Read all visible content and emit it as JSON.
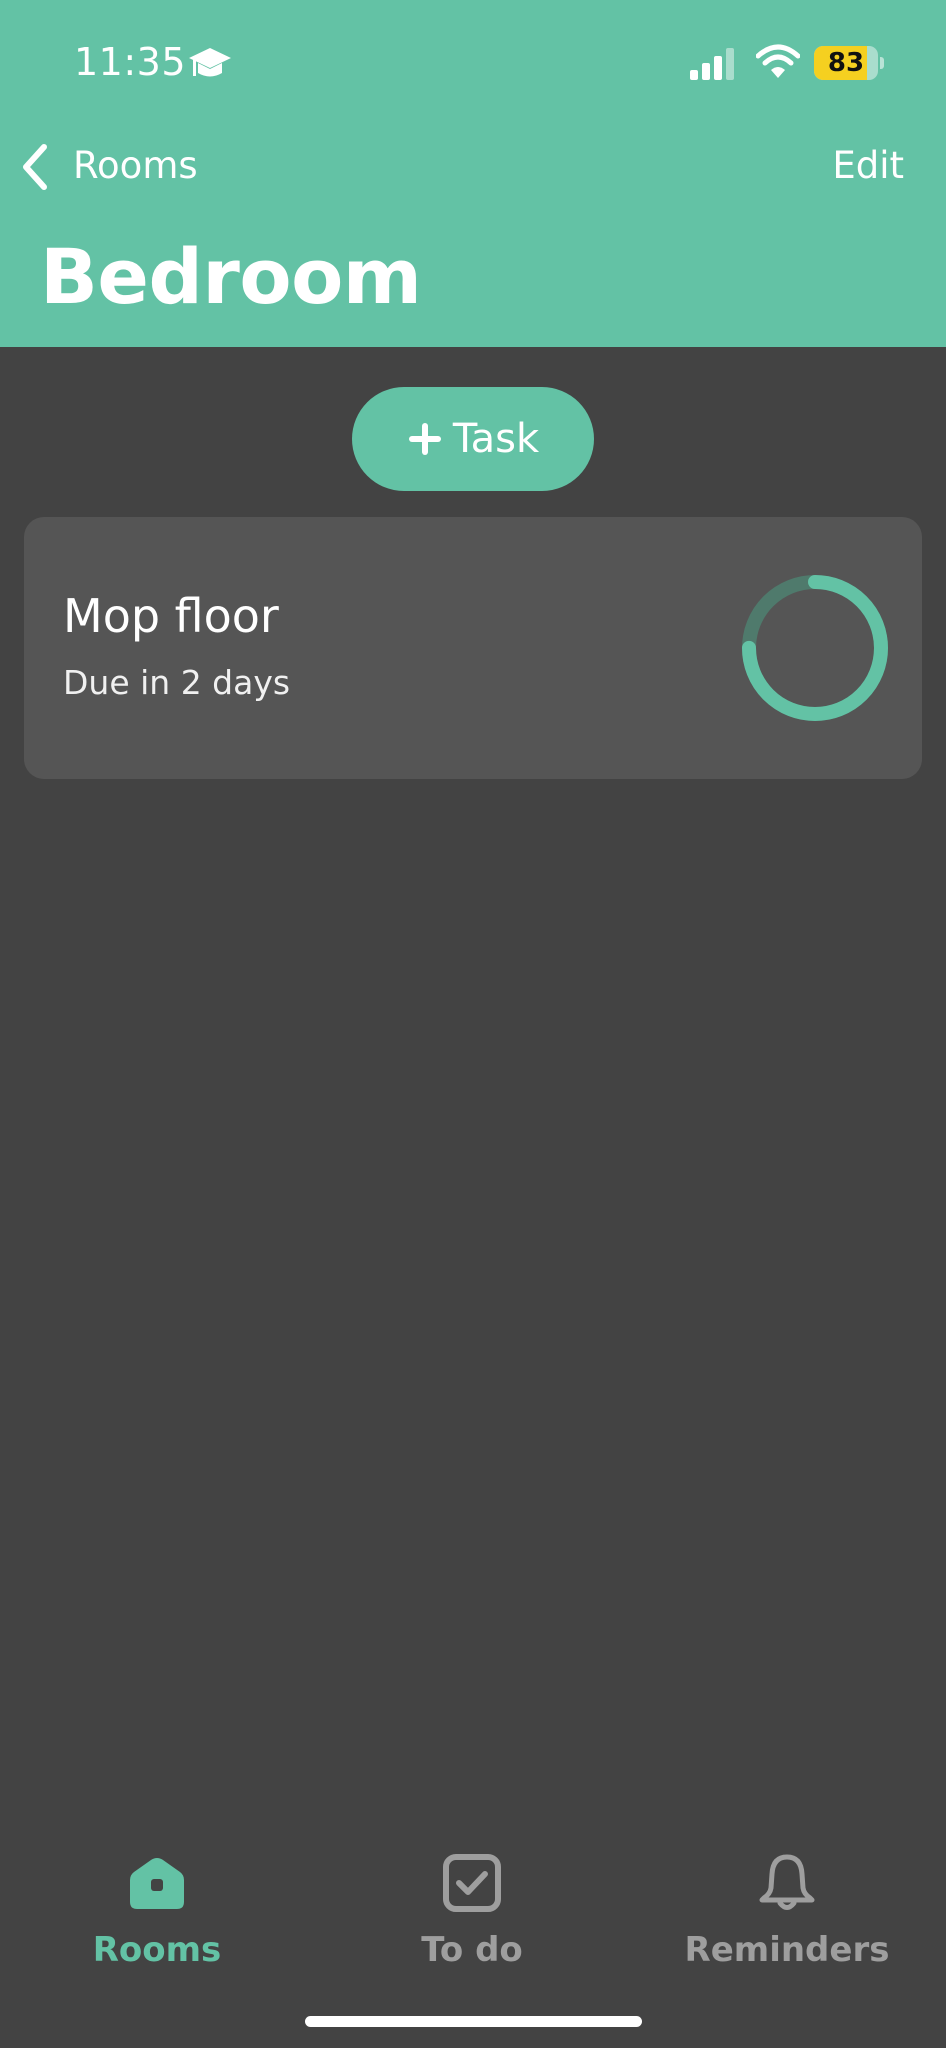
{
  "status_bar": {
    "time": "11:35",
    "battery_level": "83",
    "battery_fraction": 0.83
  },
  "nav": {
    "back_label": "Rooms",
    "edit_label": "Edit",
    "title": "Bedroom"
  },
  "add_task": {
    "label": "Task",
    "icon": "plus-icon"
  },
  "tasks": [
    {
      "title": "Mop floor",
      "due": "Due in 2 days",
      "progress_fraction": 0.75
    }
  ],
  "tab_bar": {
    "items": [
      {
        "label": "Rooms",
        "icon": "house-icon",
        "selected": true
      },
      {
        "label": "To do",
        "icon": "checkbox-icon",
        "selected": false
      },
      {
        "label": "Reminders",
        "icon": "bell-icon",
        "selected": false
      }
    ]
  },
  "colors": {
    "accent": "#63c2a5",
    "background": "#434343",
    "card": "#555555",
    "tab_inactive": "#9e9e9e",
    "battery": "#f5d020"
  }
}
